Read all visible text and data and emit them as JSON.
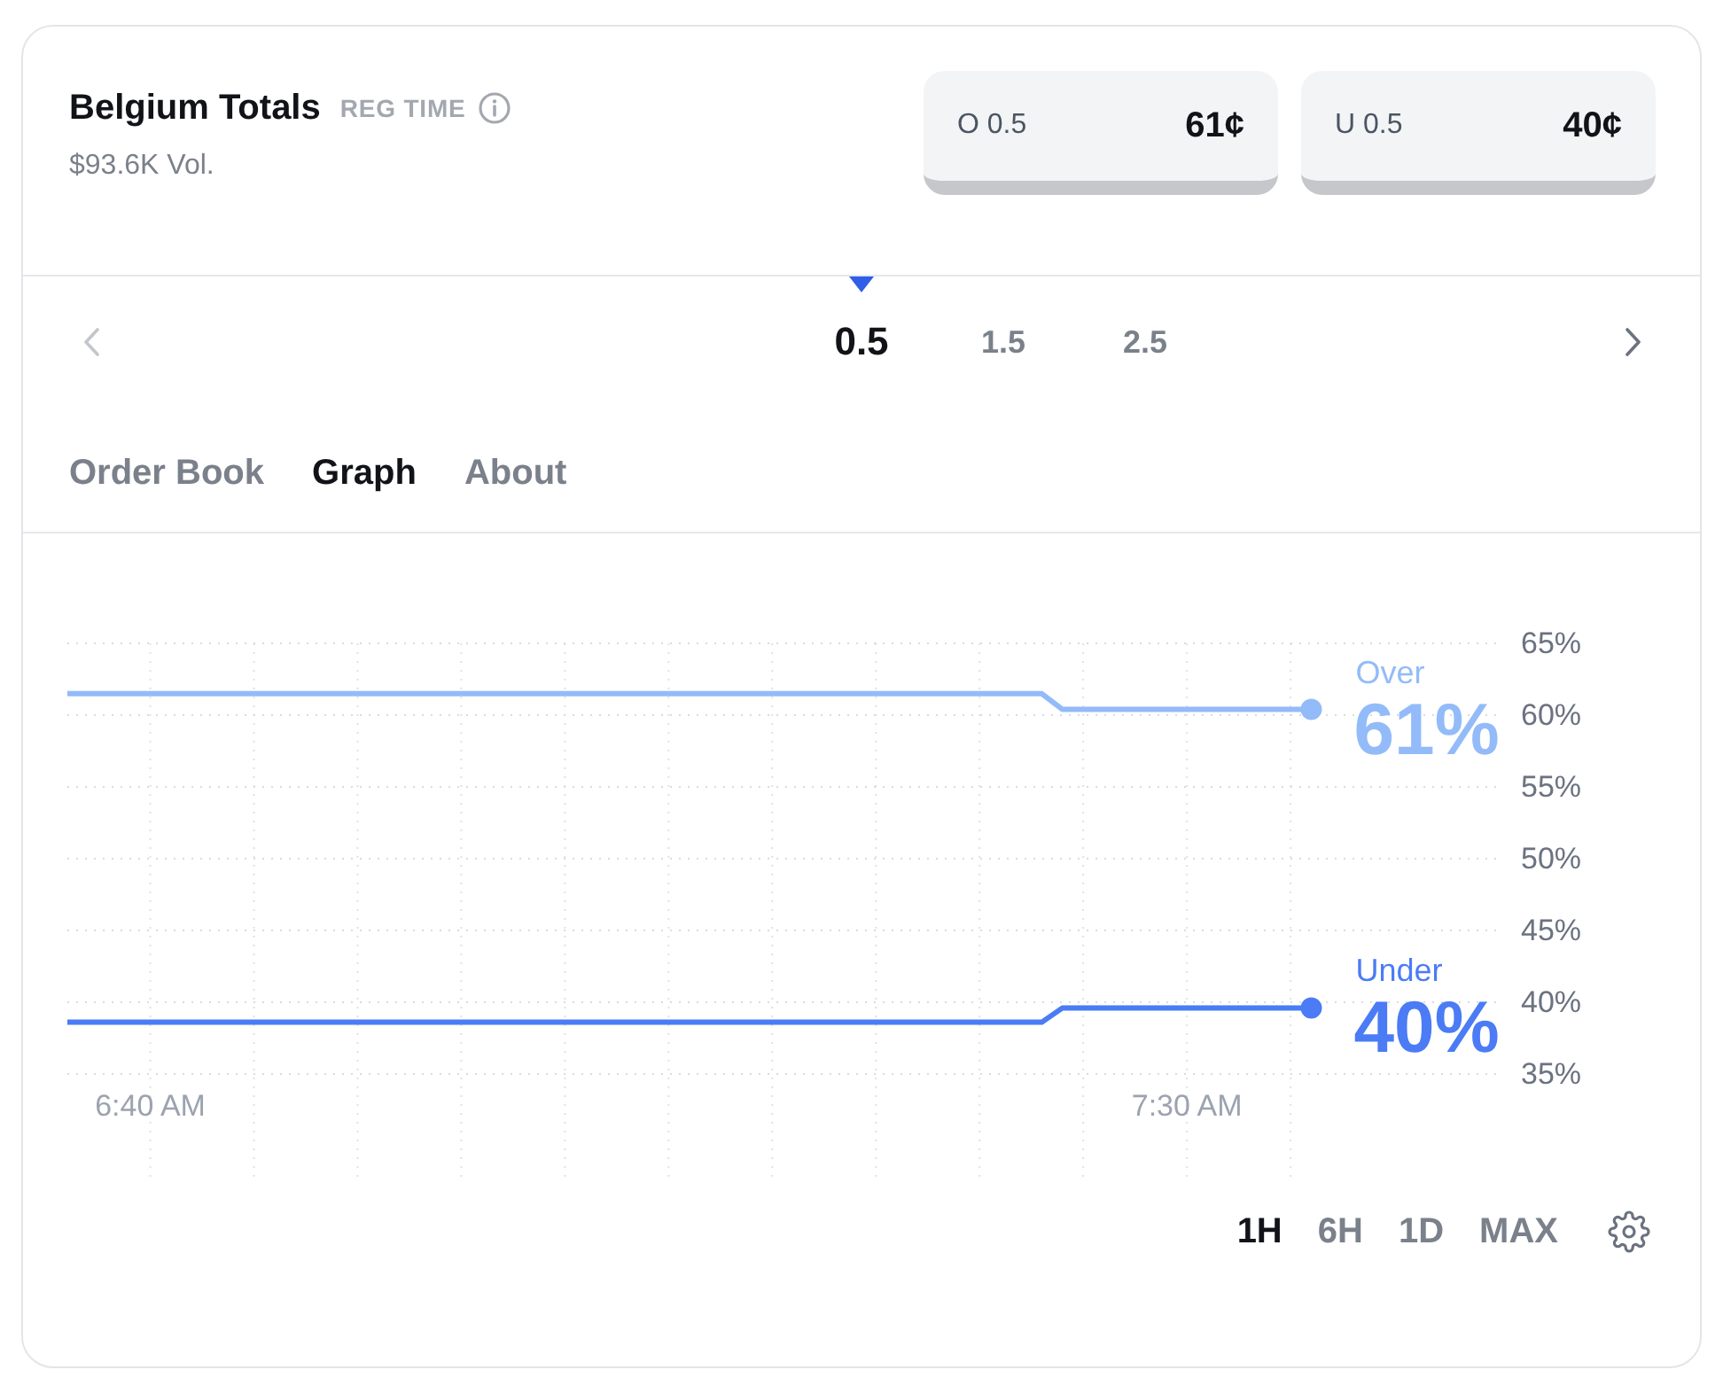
{
  "market": {
    "title": "Belgium Totals",
    "tag": "REG TIME",
    "volume": "$93.6K Vol."
  },
  "outcomes": [
    {
      "label": "O 0.5",
      "price": "61¢"
    },
    {
      "label": "U 0.5",
      "price": "40¢"
    }
  ],
  "lines": {
    "prev": {
      "disabled": true
    },
    "next": {
      "disabled": false
    },
    "items": [
      {
        "label": "0.5",
        "selected": true
      },
      {
        "label": "1.5",
        "selected": false
      },
      {
        "label": "2.5",
        "selected": false
      }
    ]
  },
  "tabs": [
    {
      "label": "Order Book",
      "selected": false
    },
    {
      "label": "Graph",
      "selected": true
    },
    {
      "label": "About",
      "selected": false
    }
  ],
  "chart": {
    "chart_data": {
      "type": "line",
      "grid": true,
      "categories": [
        null,
        null,
        null,
        null,
        "6:40 AM",
        null,
        null,
        null,
        null,
        null,
        null,
        null,
        null,
        null,
        null,
        null,
        null,
        null,
        null,
        null,
        null,
        null,
        null,
        null,
        null,
        null,
        null,
        null,
        null,
        null,
        null,
        null,
        null,
        null,
        null,
        null,
        null,
        null,
        null,
        null,
        null,
        null,
        null,
        null,
        null,
        null,
        null,
        null,
        null,
        null,
        null,
        null,
        null,
        null,
        "7:30 AM",
        null,
        null,
        null,
        null,
        null,
        null
      ],
      "series": [
        {
          "name": "Over",
          "color": "#93bbf9",
          "values": [
            61.5,
            61.5,
            61.5,
            61.5,
            61.5,
            61.5,
            61.5,
            61.5,
            61.5,
            61.5,
            61.5,
            61.5,
            61.5,
            61.5,
            61.5,
            61.5,
            61.5,
            61.5,
            61.5,
            61.5,
            61.5,
            61.5,
            61.5,
            61.5,
            61.5,
            61.5,
            61.5,
            61.5,
            61.5,
            61.5,
            61.5,
            61.5,
            61.5,
            61.5,
            61.5,
            61.5,
            61.5,
            61.5,
            61.5,
            61.5,
            61.5,
            61.5,
            61.5,
            61.5,
            61.5,
            61.5,
            61.5,
            61.5,
            60.4,
            60.4,
            60.4,
            60.4,
            60.4,
            60.4,
            60.4,
            60.4,
            60.4,
            60.4,
            60.4,
            60.4,
            60.4
          ]
        },
        {
          "name": "Under",
          "color": "#4b7bf5",
          "values": [
            38.6,
            38.6,
            38.6,
            38.6,
            38.6,
            38.6,
            38.6,
            38.6,
            38.6,
            38.6,
            38.6,
            38.6,
            38.6,
            38.6,
            38.6,
            38.6,
            38.6,
            38.6,
            38.6,
            38.6,
            38.6,
            38.6,
            38.6,
            38.6,
            38.6,
            38.6,
            38.6,
            38.6,
            38.6,
            38.6,
            38.6,
            38.6,
            38.6,
            38.6,
            38.6,
            38.6,
            38.6,
            38.6,
            38.6,
            38.6,
            38.6,
            38.6,
            38.6,
            38.6,
            38.6,
            38.6,
            38.6,
            38.6,
            39.6,
            39.6,
            39.6,
            39.6,
            39.6,
            39.6,
            39.6,
            39.6,
            39.6,
            39.6,
            39.6,
            39.6,
            39.6
          ]
        }
      ],
      "ylim": [
        35,
        65
      ],
      "yticks": [
        {
          "value": 65,
          "label": "65%"
        },
        {
          "value": 60,
          "label": "60%"
        },
        {
          "value": 55,
          "label": "55%"
        },
        {
          "value": 50,
          "label": "50%"
        },
        {
          "value": 45,
          "label": "45%"
        },
        {
          "value": 40,
          "label": "40%"
        },
        {
          "value": 35,
          "label": "35%"
        }
      ],
      "annotations": [
        "61%",
        "40%"
      ]
    }
  },
  "ranges": [
    {
      "label": "1H",
      "selected": true
    },
    {
      "label": "6H",
      "selected": false
    },
    {
      "label": "1D",
      "selected": false
    },
    {
      "label": "MAX",
      "selected": false
    }
  ]
}
